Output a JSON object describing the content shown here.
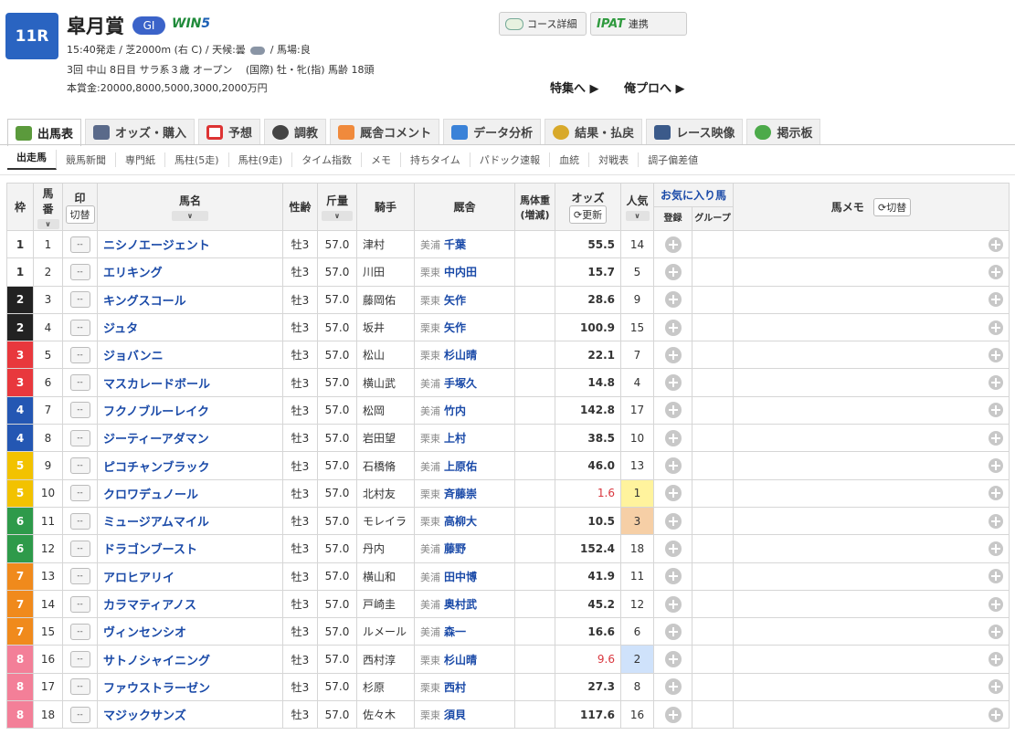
{
  "race": {
    "number": "11R",
    "title": "皐月賞",
    "grade": "GI",
    "win5_a": "WIN",
    "win5_b": "5",
    "info1": "15:40発走 / 芝2000m (右 C) / 天候:曇",
    "info1_b": "/ 馬場:良",
    "info2": "3回 中山 8日目 サラ系３歳 オープン　 (国際) 牡・牝(指) 馬齢 18頭",
    "info3": "本賞金:20000,8000,5000,3000,2000万円",
    "course_btn": "コース詳細",
    "ipat_logo": "IPAT",
    "ipat_btn": "連携",
    "link_feature": "特集へ ▶",
    "link_pro": "俺プロへ ▶"
  },
  "tabs": [
    "出馬表",
    "オッズ・購入",
    "予想",
    "調教",
    "厩舎コメント",
    "データ分析",
    "結果・払戻",
    "レース映像",
    "掲示板"
  ],
  "subtabs": [
    "出走馬",
    "競馬新聞",
    "専門紙",
    "馬柱(5走)",
    "馬柱(9走)",
    "タイム指数",
    "メモ",
    "持ちタイム",
    "パドック速報",
    "血統",
    "対戦表",
    "調子偏差値"
  ],
  "columns": {
    "waku": "枠",
    "umaban_1": "馬",
    "umaban_2": "番",
    "mark": "印",
    "mark_toggle": "切替",
    "name": "馬名",
    "sexage": "性齢",
    "weight": "斤量",
    "jockey": "騎手",
    "stable": "厩舎",
    "body_1": "馬体重",
    "body_2": "(増減)",
    "odds": "オッズ",
    "odds_update": "更新",
    "pop": "人気",
    "fav": "お気に入り馬",
    "fav_reg": "登録",
    "fav_group": "グループ",
    "memo": "馬メモ",
    "memo_toggle": "切替",
    "sort_arrow": "∨"
  },
  "mark_placeholder": "--",
  "waku_colors": {
    "1": "#ffffff",
    "2": "#222222",
    "3": "#e8383d",
    "4": "#2457b3",
    "5": "#f2c200",
    "6": "#2e9a4a",
    "7": "#f08a1c",
    "8": "#f37f98"
  },
  "horses": [
    {
      "waku": "1",
      "num": "1",
      "name": "ニシノエージェント",
      "sexage": "牡3",
      "weight": "57.0",
      "jockey": "津村",
      "loc": "美浦",
      "trainer": "千葉",
      "odds": "55.5",
      "pop": "14"
    },
    {
      "waku": "1",
      "num": "2",
      "name": "エリキング",
      "sexage": "牡3",
      "weight": "57.0",
      "jockey": "川田",
      "loc": "栗東",
      "trainer": "中内田",
      "odds": "15.7",
      "pop": "5"
    },
    {
      "waku": "2",
      "num": "3",
      "name": "キングスコール",
      "sexage": "牡3",
      "weight": "57.0",
      "jockey": "藤岡佑",
      "loc": "栗東",
      "trainer": "矢作",
      "odds": "28.6",
      "pop": "9"
    },
    {
      "waku": "2",
      "num": "4",
      "name": "ジュタ",
      "sexage": "牡3",
      "weight": "57.0",
      "jockey": "坂井",
      "loc": "栗東",
      "trainer": "矢作",
      "odds": "100.9",
      "pop": "15"
    },
    {
      "waku": "3",
      "num": "5",
      "name": "ジョバンニ",
      "sexage": "牡3",
      "weight": "57.0",
      "jockey": "松山",
      "loc": "栗東",
      "trainer": "杉山晴",
      "odds": "22.1",
      "pop": "7"
    },
    {
      "waku": "3",
      "num": "6",
      "name": "マスカレードボール",
      "sexage": "牡3",
      "weight": "57.0",
      "jockey": "横山武",
      "loc": "美浦",
      "trainer": "手塚久",
      "odds": "14.8",
      "pop": "4"
    },
    {
      "waku": "4",
      "num": "7",
      "name": "フクノブルーレイク",
      "sexage": "牡3",
      "weight": "57.0",
      "jockey": "松岡",
      "loc": "美浦",
      "trainer": "竹内",
      "odds": "142.8",
      "pop": "17"
    },
    {
      "waku": "4",
      "num": "8",
      "name": "ジーティーアダマン",
      "sexage": "牡3",
      "weight": "57.0",
      "jockey": "岩田望",
      "loc": "栗東",
      "trainer": "上村",
      "odds": "38.5",
      "pop": "10"
    },
    {
      "waku": "5",
      "num": "9",
      "name": "ピコチャンブラック",
      "sexage": "牡3",
      "weight": "57.0",
      "jockey": "石橋脩",
      "loc": "美浦",
      "trainer": "上原佑",
      "odds": "46.0",
      "pop": "13"
    },
    {
      "waku": "5",
      "num": "10",
      "name": "クロワデュノール",
      "sexage": "牡3",
      "weight": "57.0",
      "jockey": "北村友",
      "loc": "栗東",
      "trainer": "斉藤崇",
      "odds": "1.6",
      "pop": "1"
    },
    {
      "waku": "6",
      "num": "11",
      "name": "ミュージアムマイル",
      "sexage": "牡3",
      "weight": "57.0",
      "jockey": "モレイラ",
      "loc": "栗東",
      "trainer": "高柳大",
      "odds": "10.5",
      "pop": "3"
    },
    {
      "waku": "6",
      "num": "12",
      "name": "ドラゴンブースト",
      "sexage": "牡3",
      "weight": "57.0",
      "jockey": "丹内",
      "loc": "美浦",
      "trainer": "藤野",
      "odds": "152.4",
      "pop": "18"
    },
    {
      "waku": "7",
      "num": "13",
      "name": "アロヒアリイ",
      "sexage": "牡3",
      "weight": "57.0",
      "jockey": "横山和",
      "loc": "美浦",
      "trainer": "田中博",
      "odds": "41.9",
      "pop": "11"
    },
    {
      "waku": "7",
      "num": "14",
      "name": "カラマティアノス",
      "sexage": "牡3",
      "weight": "57.0",
      "jockey": "戸崎圭",
      "loc": "美浦",
      "trainer": "奥村武",
      "odds": "45.2",
      "pop": "12"
    },
    {
      "waku": "7",
      "num": "15",
      "name": "ヴィンセンシオ",
      "sexage": "牡3",
      "weight": "57.0",
      "jockey": "ルメール",
      "loc": "美浦",
      "trainer": "森一",
      "odds": "16.6",
      "pop": "6"
    },
    {
      "waku": "8",
      "num": "16",
      "name": "サトノシャイニング",
      "sexage": "牡3",
      "weight": "57.0",
      "jockey": "西村淳",
      "loc": "栗東",
      "trainer": "杉山晴",
      "odds": "9.6",
      "pop": "2"
    },
    {
      "waku": "8",
      "num": "17",
      "name": "ファウストラーゼン",
      "sexage": "牡3",
      "weight": "57.0",
      "jockey": "杉原",
      "loc": "栗東",
      "trainer": "西村",
      "odds": "27.3",
      "pop": "8"
    },
    {
      "waku": "8",
      "num": "18",
      "name": "マジックサンズ",
      "sexage": "牡3",
      "weight": "57.0",
      "jockey": "佐々木",
      "loc": "栗東",
      "trainer": "須貝",
      "odds": "117.6",
      "pop": "16"
    }
  ]
}
